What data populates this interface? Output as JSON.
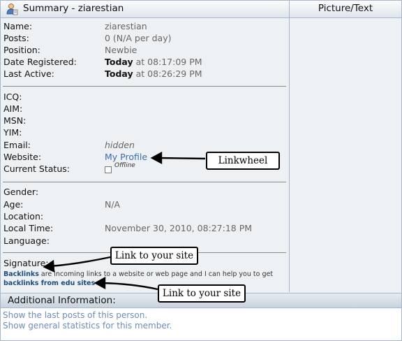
{
  "header": {
    "title": "Summary - ziarestian",
    "right_title": "Picture/Text"
  },
  "profile": {
    "name_label": "Name:",
    "name_value": "ziarestian",
    "posts_label": "Posts:",
    "posts_value": "0 (N/A per day)",
    "position_label": "Position:",
    "position_value": "Newbie",
    "registered_label": "Date Registered:",
    "registered_day": "Today",
    "registered_time": " at 08:17:09 PM",
    "active_label": "Last Active:",
    "active_day": "Today",
    "active_time": " at 08:26:29 PM"
  },
  "contact": {
    "icq_label": "ICQ:",
    "aim_label": "AIM:",
    "msn_label": "MSN:",
    "yim_label": "YIM:",
    "email_label": "Email:",
    "email_value": "hidden",
    "website_label": "Website:",
    "website_value": "My Profile",
    "status_label": "Current Status:",
    "status_value": "Offline"
  },
  "personal": {
    "gender_label": "Gender:",
    "age_label": "Age:",
    "age_value": "N/A",
    "location_label": "Location:",
    "localtime_label": "Local Time:",
    "localtime_value": "November 30, 2010, 08:27:18 PM",
    "language_label": "Language:"
  },
  "signature": {
    "label": "Signature:",
    "link1": "Backlinks",
    "text": " are incoming links to a website or web page and I can help you to get ",
    "link2": "backlinks from edu sites"
  },
  "additional": {
    "title": "Additional Information:",
    "link_posts": "Show the last posts of this person.",
    "link_stats": "Show general statistics for this member."
  },
  "annotations": {
    "linkwheel": "Linkwheel",
    "link_site_1": "Link to your site",
    "link_site_2": "Link to your site"
  },
  "colors": {
    "panel_bg": "#eef1f4",
    "link": "#3a6ea5",
    "border": "#a9b8c8"
  }
}
